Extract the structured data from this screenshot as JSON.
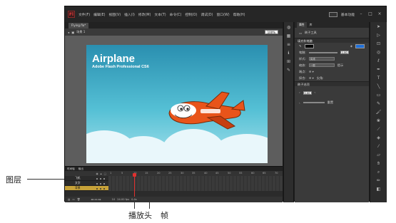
{
  "menubar": {
    "logo": "Fl",
    "items": [
      "文件(F)",
      "编辑(E)",
      "视图(V)",
      "插入(I)",
      "修改(M)",
      "文本(T)",
      "命令(C)",
      "控制(O)",
      "调试(D)",
      "窗口(W)",
      "帮助(H)"
    ],
    "workspace": "基本功能",
    "minimize": "–",
    "maximize": "□",
    "close": "×"
  },
  "document": {
    "tab_title": "Flying.fla*",
    "scene": "场景 1",
    "zoom": "100%"
  },
  "stage": {
    "title": "Airplane",
    "subtitle": "Adobe Flash Professional CS6"
  },
  "timeline": {
    "tabs": [
      "时间轴",
      "输出"
    ],
    "frame_numbers": [
      "1",
      "5",
      "10",
      "15",
      "20",
      "25",
      "30",
      "35",
      "40",
      "45",
      "50",
      "55",
      "60",
      "65",
      "70"
    ],
    "current_frame": 10,
    "layers": [
      {
        "name": "飞机",
        "selected": false
      },
      {
        "name": "文字",
        "selected": false
      },
      {
        "name": "背景",
        "selected": true
      }
    ],
    "status": [
      "10",
      "24.00 fps",
      "0.4s"
    ]
  },
  "properties": {
    "tabs": [
      "属性",
      "库"
    ],
    "tool_name": "刷子工具",
    "sections": [
      "填充和笔触",
      "刷子选项"
    ],
    "stroke_label": "笔触:",
    "stroke_value": "1.00",
    "style_label": "样式:",
    "style_value": "实线",
    "scale_label": "缩放:",
    "scale_value": "一般",
    "hint_label": "提示",
    "cap_label": "端点:",
    "join_label": "接合:",
    "miter_label": "尖角:",
    "brush_size": "1.00",
    "reset_label": "重置"
  },
  "callouts": {
    "layers": "图层",
    "playhead": "播放头",
    "frame": "帧"
  },
  "colors": {
    "accent_selected_layer": "#c7a239",
    "playhead": "#e0302e",
    "stage_top": "#2a8fb0"
  }
}
